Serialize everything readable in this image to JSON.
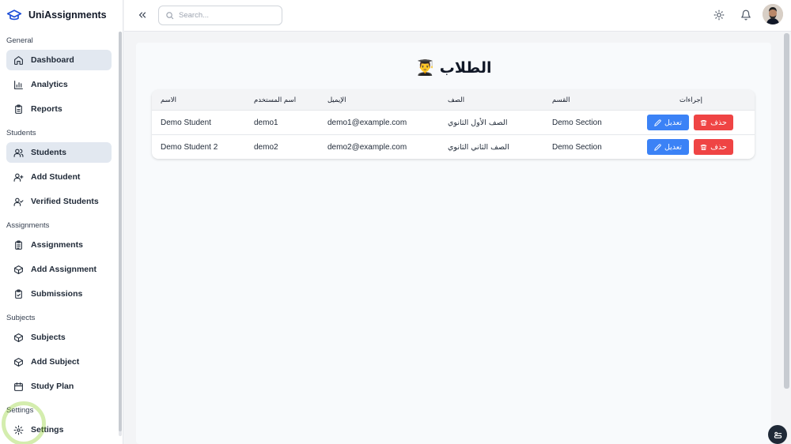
{
  "brand": {
    "name": "UniAssignments"
  },
  "sidebar": {
    "sections": [
      {
        "title": "General",
        "items": [
          {
            "label": "Dashboard",
            "icon": "home-icon"
          },
          {
            "label": "Analytics",
            "icon": "bar-chart-icon"
          },
          {
            "label": "Reports",
            "icon": "clipboard-icon"
          }
        ]
      },
      {
        "title": "Students",
        "items": [
          {
            "label": "Students",
            "icon": "users-icon"
          },
          {
            "label": "Add Student",
            "icon": "user-plus-icon"
          },
          {
            "label": "Verified Students",
            "icon": "user-check-icon"
          }
        ]
      },
      {
        "title": "Assignments",
        "items": [
          {
            "label": "Assignments",
            "icon": "clipboard-list-icon"
          },
          {
            "label": "Add Assignment",
            "icon": "box-plus-icon"
          },
          {
            "label": "Submissions",
            "icon": "clipboard-check-icon"
          }
        ]
      },
      {
        "title": "Subjects",
        "items": [
          {
            "label": "Subjects",
            "icon": "box-icon"
          },
          {
            "label": "Add Subject",
            "icon": "box-plus-icon"
          },
          {
            "label": "Study Plan",
            "icon": "calendar-icon"
          }
        ]
      },
      {
        "title": "Settings",
        "items": [
          {
            "label": "Settings",
            "icon": "gear-icon"
          }
        ]
      }
    ],
    "active": [
      "Dashboard",
      "Students"
    ]
  },
  "header": {
    "search_placeholder": "Search..."
  },
  "page": {
    "title": "الطلاب 👨‍🎓"
  },
  "table": {
    "columns": {
      "name": "الاسم",
      "username": "اسم المستخدم",
      "email": "الإيميل",
      "class": "الصف",
      "section": "القسم",
      "actions": "إجراءات"
    },
    "rows": [
      {
        "name": "Demo Student",
        "username": "demo1",
        "email": "demo1@example.com",
        "class": "الصف الأول الثانوي",
        "section": "Demo Section"
      },
      {
        "name": "Demo Student 2",
        "username": "demo2",
        "email": "demo2@example.com",
        "class": "الصف الثاني الثانوي",
        "section": "Demo Section"
      }
    ],
    "edit_label": "تعديل",
    "delete_label": "حذف"
  },
  "colors": {
    "primary": "#3b82f6",
    "danger": "#ef4444",
    "brand": "#1d4ed8",
    "active_bg": "#e2e8f0"
  }
}
